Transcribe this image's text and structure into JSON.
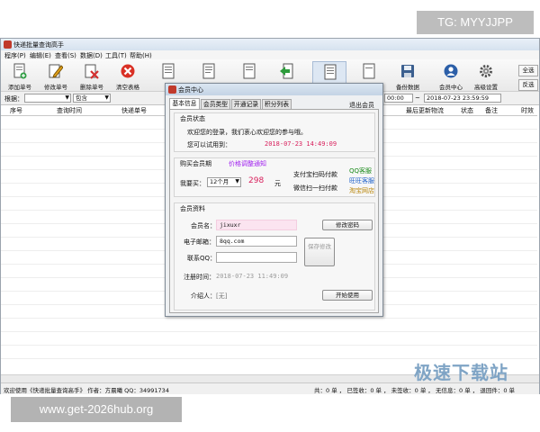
{
  "watermarks": {
    "tg": "TG: MYYJJPP",
    "url": "www.get-2026hub.org",
    "site_logo": "极速下载站"
  },
  "app": {
    "title": "快递批量查询高手"
  },
  "menu": [
    "程序(P)",
    "编辑(E)",
    "查看(S)",
    "数据(D)",
    "工具(T)",
    "帮助(H)"
  ],
  "toolbar": [
    {
      "label": "添加单号",
      "icon": "add-doc-icon"
    },
    {
      "label": "修改单号",
      "icon": "edit-pencil-icon"
    },
    {
      "label": "删除单号",
      "icon": "delete-x-icon"
    },
    {
      "label": "清空表格",
      "icon": "clear-red-icon"
    },
    {
      "label": "刷",
      "icon": "refresh-doc-icon"
    },
    {
      "label": "",
      "icon": "doc-list-icon"
    },
    {
      "label": "",
      "icon": "doc-check-icon"
    },
    {
      "label": "",
      "icon": "import-arrow-icon"
    },
    {
      "label": "",
      "icon": "print-icon"
    },
    {
      "label": "",
      "icon": "export-doc-icon"
    },
    {
      "label": "备份数据",
      "icon": "save-disk-icon"
    },
    {
      "label": "会员中心",
      "icon": "user-center-icon"
    },
    {
      "label": "高级设置",
      "icon": "gear-icon"
    }
  ],
  "right_buttons": {
    "select_all": "全选",
    "invert": "反选"
  },
  "filter": {
    "label": "根据：",
    "mode": "包含",
    "time_start_tail": "00:00",
    "time_end": "2018-07-23 23:59:59"
  },
  "columns": [
    "序号",
    "查询时间",
    "快递单号",
    "最后更新物流",
    "状态",
    "备注",
    "时效"
  ],
  "status": {
    "left": "欢迎使用《快递批量查询高手》 作者：方晨曦   QQ：34991734",
    "right": "共：0 单 ， 已签收：0 单 ， 未签收：0 单 ， 无信息：0 单 ， 退回件：0 单"
  },
  "dialog": {
    "title": "会员中心",
    "tabs": [
      "基本信息",
      "会员类型",
      "开通记录",
      "积分列表"
    ],
    "exit_label": "退出会员",
    "status_group": {
      "caption": "会员状态",
      "welcome": "欢迎您的登录，我们衷心欢迎您的参与哦。",
      "valid_label": "您可以试用到：",
      "valid_until": "2018-07-23 14:49:09"
    },
    "buy_group": {
      "caption": "购买会员期",
      "price_notice": "价格调整通知",
      "buy_label": "我要买：",
      "period": "12个月",
      "price": "298",
      "unit": "元",
      "alipay": "支付宝扫码付款",
      "wechat": "微信扫一扫付款",
      "qq_service": "QQ客服",
      "wangwang_service": "旺旺客服",
      "taobao_shop": "淘宝网店"
    },
    "profile_group": {
      "caption": "会员资料",
      "name_label": "会员名：",
      "name_value": "jixuxr",
      "change_pw": "修改密码",
      "email_label": "电子邮箱：",
      "email_value": "        8qq.com",
      "qq_label": "联系QQ：",
      "qq_value": "",
      "save_btn": "保存修改",
      "reg_label": "注册时间：",
      "reg_value": "2018-07-23 11:49:09",
      "referrer_label": "介绍人：",
      "referrer_value": "[无]",
      "start_btn": "开始使用"
    }
  }
}
